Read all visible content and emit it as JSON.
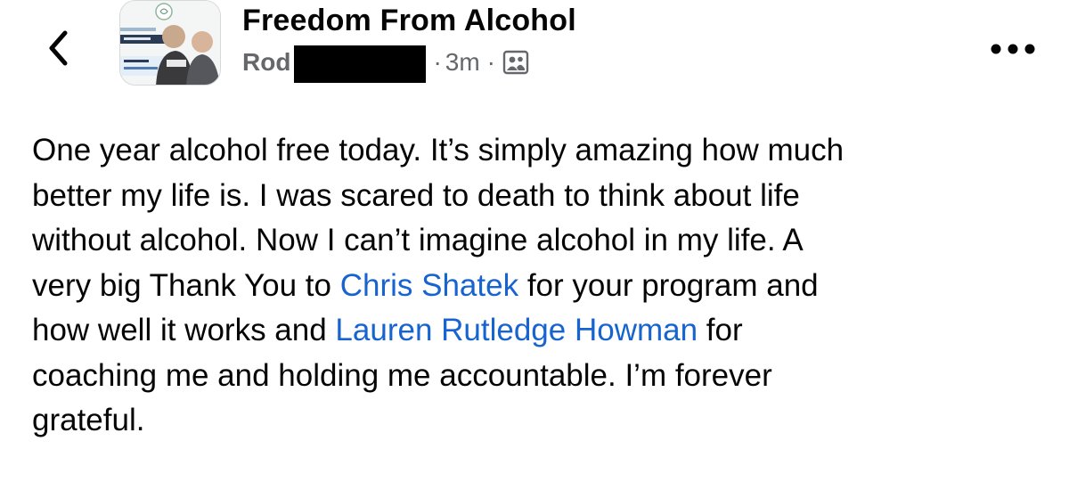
{
  "post": {
    "group_name": "Freedom From Alcohol",
    "author": "Rod",
    "timestamp": "3m",
    "separator": "·",
    "audience_icon": "group-members-icon",
    "body": {
      "line1": "One year alcohol free today.  It’s simply amazing how much",
      "line2": "better my life is.  I was scared to death to think about life",
      "line3": "without alcohol.  Now I can’t imagine alcohol in my life.  A",
      "line4_pre": "very big Thank You to ",
      "mention1": "Chris Shatek",
      "line4_post": " for your program and",
      "line5_pre": "how well it works and ",
      "mention2": "Lauren Rutledge Howman",
      "line5_post": " for",
      "line6": "coaching me and holding me accountable.  I’m forever",
      "line7": "grateful."
    }
  },
  "icons": {
    "back": "chevron-left-icon",
    "more": "more-dots-icon"
  },
  "colors": {
    "text": "#050505",
    "meta": "#65676b",
    "mention": "#1763cf",
    "redaction": "#000000"
  }
}
